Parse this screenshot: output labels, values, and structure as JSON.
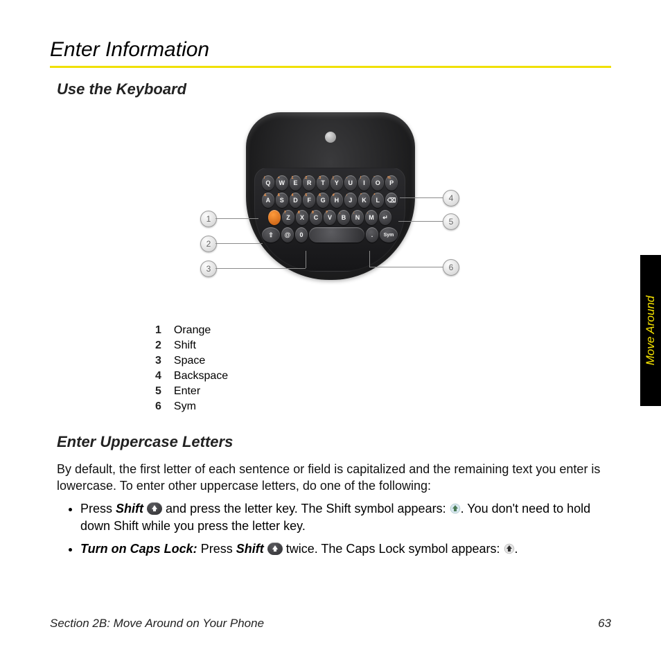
{
  "header": {
    "title": "Enter Information"
  },
  "side_tab": {
    "label": "Move Around"
  },
  "section1": {
    "heading": "Use the Keyboard",
    "callouts": [
      {
        "num": "1",
        "label": "Orange"
      },
      {
        "num": "2",
        "label": "Shift"
      },
      {
        "num": "3",
        "label": "Space"
      },
      {
        "num": "4",
        "label": "Backspace"
      },
      {
        "num": "5",
        "label": "Enter"
      },
      {
        "num": "6",
        "label": "Sym"
      }
    ],
    "keyboard_rows": [
      [
        "Q",
        "W",
        "E",
        "R",
        "T",
        "Y",
        "U",
        "I",
        "O",
        "P"
      ],
      [
        "A",
        "S",
        "D",
        "F",
        "G",
        "H",
        "J",
        "K",
        "L"
      ],
      [
        "Z",
        "X",
        "C",
        "V",
        "B",
        "N",
        "M"
      ]
    ]
  },
  "section2": {
    "heading": "Enter Uppercase Letters",
    "intro": "By default, the first letter of each sentence or field is capitalized and the remaining text you enter is lowercase. To enter other uppercase letters, do one of the following:",
    "bullets": [
      {
        "lead": "Press ",
        "bold": "Shift",
        "mid1": " and press the letter key. The Shift symbol appears: ",
        "tail": ". You don't need to hold down Shift while you press the letter key."
      },
      {
        "lead_bold": "Turn on Caps Lock:",
        "mid0": " Press ",
        "bold2": "Shift",
        "mid1": " twice. The Caps Lock symbol appears: ",
        "tail": "."
      }
    ]
  },
  "footer": {
    "section": "Section 2B: Move Around on Your Phone",
    "page": "63"
  }
}
